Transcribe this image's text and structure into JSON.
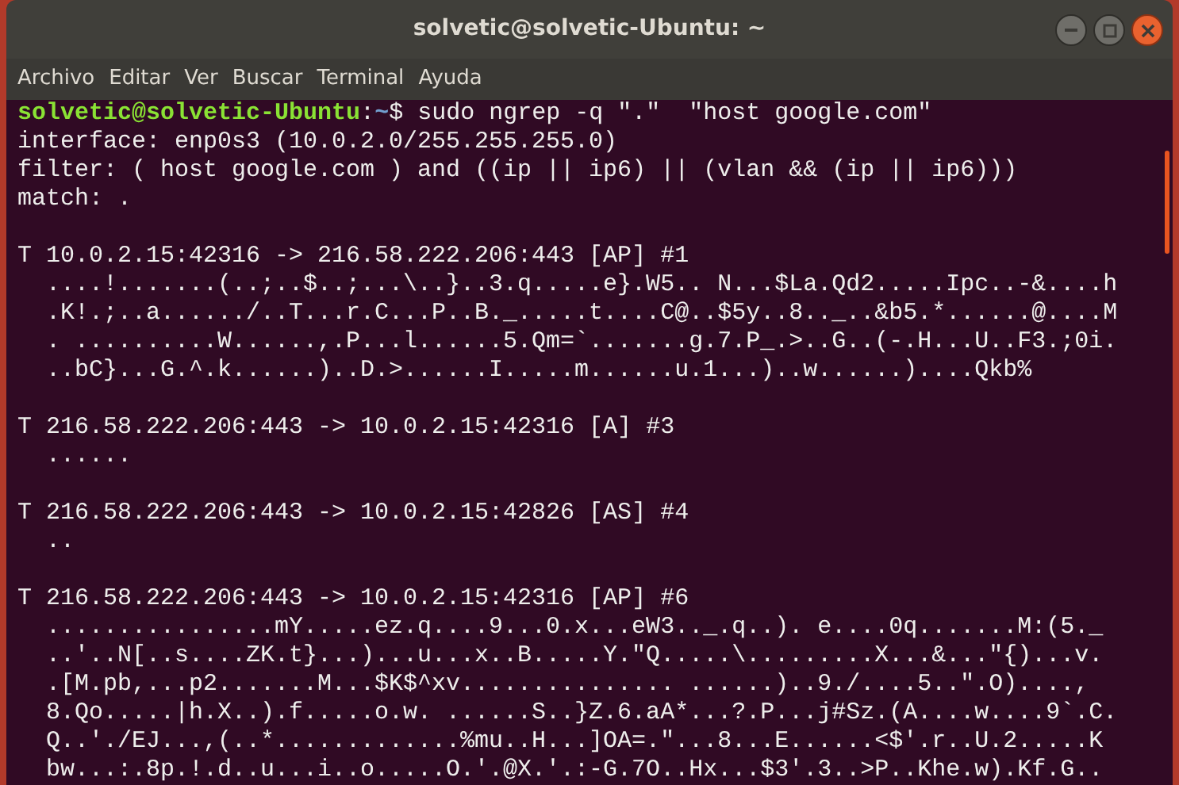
{
  "window": {
    "title": "solvetic@solvetic-Ubuntu: ~"
  },
  "menu": [
    "Archivo",
    "Editar",
    "Ver",
    "Buscar",
    "Terminal",
    "Ayuda"
  ],
  "terminal": {
    "prompt": {
      "user_host": "solvetic@solvetic-Ubuntu",
      "separator": ":",
      "path": "~",
      "command": "$ sudo ngrep -q \".\"  \"host google.com\""
    },
    "info": [
      "interface: enp0s3 (10.0.2.0/255.255.255.0)",
      "filter: ( host google.com ) and ((ip || ip6) || (vlan && (ip || ip6)))",
      "match: ."
    ],
    "packets": [
      {
        "header": "T 10.0.2.15:42316 -> 216.58.222.206:443 [AP] #1",
        "payload": [
          "....!.......(..;..$..;...\\..}..3.q.....e}.W5.. N...$La.Qd2.....Ipc..-&....h",
          ".K!.;..a....../..T...r.C...P..B._.....t....C@..$5y..8.._..&b5.*......@....M",
          ". ..........W......,.P...l......5.Qm=`.......g.7.P_.>..G..(-.H...U..F3.;0i.",
          "..bC}...G.^.k......)..D.>......I.....m......u.1...)..w......)....Qkb%"
        ]
      },
      {
        "header": "T 216.58.222.206:443 -> 10.0.2.15:42316 [A] #3",
        "payload": [
          "......"
        ]
      },
      {
        "header": "T 216.58.222.206:443 -> 10.0.2.15:42826 [AS] #4",
        "payload": [
          ".."
        ]
      },
      {
        "header": "T 216.58.222.206:443 -> 10.0.2.15:42316 [AP] #6",
        "payload": [
          "................mY.....ez.q....9...0.x...eW3.._.q..). e....0q.......M:(5._",
          "..'..N[..s....ZK.t}...)...u...x..B.....Y.\"Q.....\\.........X...&...\"{)...v.",
          ".[M.pb,...p2.......M...$K$^xv............... ......)..9./....5..\".O)....,",
          "8.Qo.....|h.X..).f.....o.w. ......S..}Z.6.aA*...?.P...j#Sz.(A....w....9`.C.",
          "Q..'./EJ...,(..*.............%mu..H...]OA=.\"...8...E......<$'.r..U.2.....K",
          "bw...:.8p.!.d..u...i..o.....O.'.@X.'.:-G.7O..Hx...$3'.3..>P..Khe.w).Kf.G.."
        ]
      }
    ]
  }
}
